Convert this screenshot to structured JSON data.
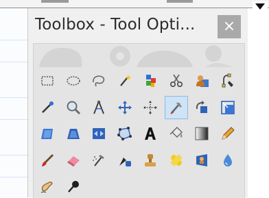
{
  "window": {
    "title": "Toolbox - Tool Opti...",
    "close_label": "×"
  },
  "colors": {
    "panel_bg": "#e4e4e4",
    "selected_tool_bg": "#cfe3f6",
    "close_button_bg": "#a9a9a9"
  },
  "tools": [
    {
      "name": "rectangle-select-tool-icon"
    },
    {
      "name": "ellipse-select-tool-icon"
    },
    {
      "name": "free-select-tool-icon"
    },
    {
      "name": "fuzzy-select-tool-icon"
    },
    {
      "name": "select-by-color-tool-icon"
    },
    {
      "name": "scissors-select-tool-icon"
    },
    {
      "name": "foreground-select-tool-icon"
    },
    {
      "name": "paths-tool-icon"
    },
    {
      "name": "color-picker-tool-icon"
    },
    {
      "name": "zoom-tool-icon"
    },
    {
      "name": "measure-tool-icon"
    },
    {
      "name": "move-tool-icon"
    },
    {
      "name": "alignment-tool-icon"
    },
    {
      "name": "crop-tool-icon",
      "selected": true
    },
    {
      "name": "rotate-tool-icon"
    },
    {
      "name": "scale-tool-icon"
    },
    {
      "name": "shear-tool-icon"
    },
    {
      "name": "perspective-tool-icon"
    },
    {
      "name": "flip-tool-icon"
    },
    {
      "name": "cage-transform-tool-icon"
    },
    {
      "name": "text-tool-icon"
    },
    {
      "name": "bucket-fill-tool-icon"
    },
    {
      "name": "blend-tool-icon"
    },
    {
      "name": "pencil-tool-icon"
    },
    {
      "name": "paintbrush-tool-icon"
    },
    {
      "name": "eraser-tool-icon"
    },
    {
      "name": "airbrush-tool-icon"
    },
    {
      "name": "ink-tool-icon"
    },
    {
      "name": "clone-tool-icon"
    },
    {
      "name": "heal-tool-icon"
    },
    {
      "name": "perspective-clone-tool-icon"
    },
    {
      "name": "blur-sharpen-tool-icon"
    },
    {
      "name": "smudge-tool-icon"
    },
    {
      "name": "dodge-burn-tool-icon"
    }
  ]
}
